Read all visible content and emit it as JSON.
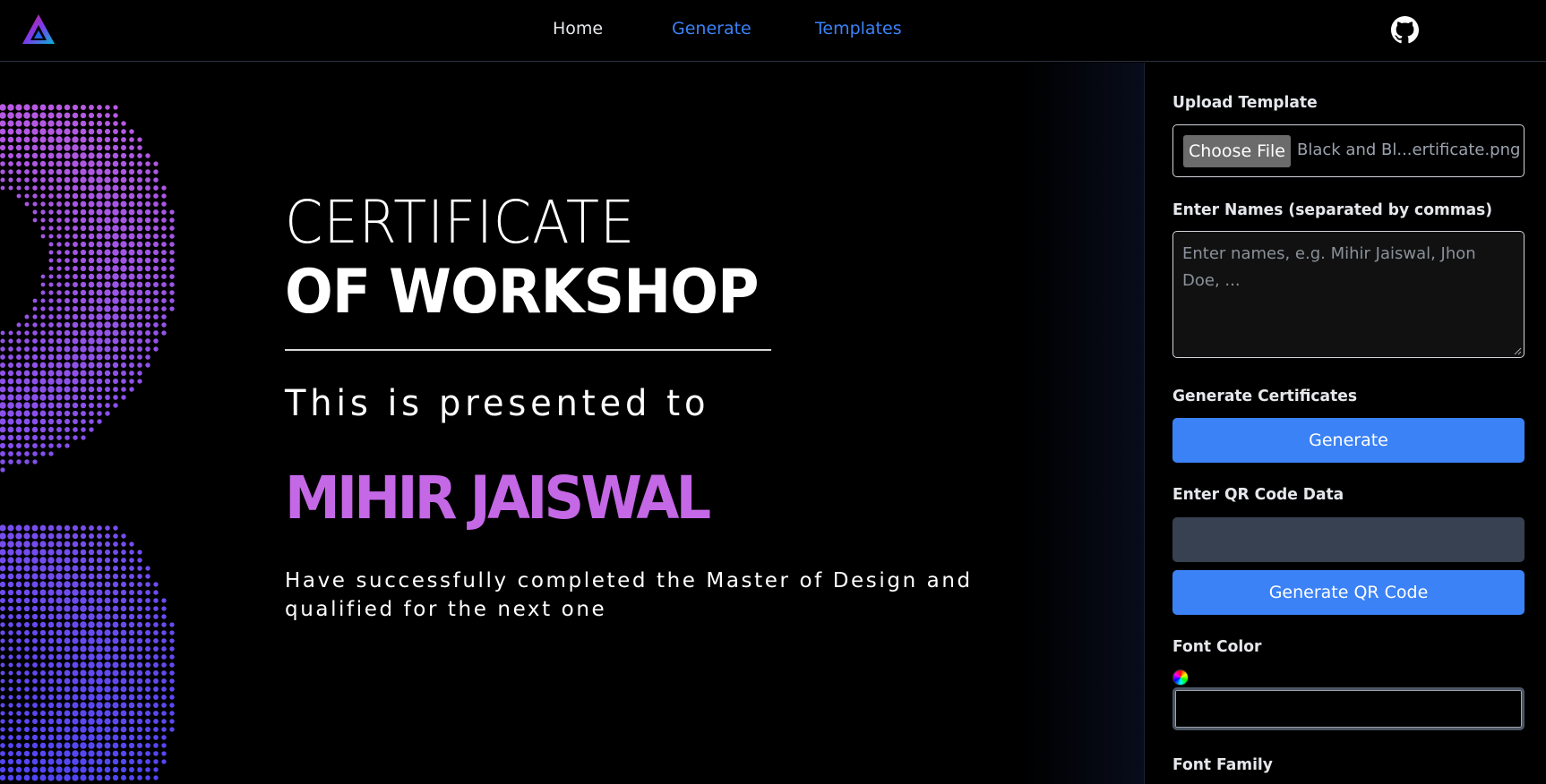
{
  "nav": {
    "links": [
      "Home",
      "Generate",
      "Templates"
    ],
    "home_color": "#e5e7eb",
    "link_color": "#3b82f6"
  },
  "icons": {
    "logo": "triangle-logo-icon",
    "github": "github-icon",
    "color_picker": "color-wheel-icon",
    "resize": "resize-grip-icon"
  },
  "certificate": {
    "line1": "CERTIFICATE",
    "line2": "OF WORKSHOP",
    "presented": "This is presented to",
    "name": "MIHIR JAISWAL",
    "description": "Have successfully completed the Master of Design and qualified for the next one",
    "name_color": "#c468e6",
    "accent_colors": [
      "#7c3aed",
      "#c468e6",
      "#2563eb"
    ]
  },
  "panel": {
    "upload_label": "Upload Template",
    "choose_file": "Choose File",
    "file_name": "Black and Bl...ertificate.png",
    "names_label": "Enter Names (separated by commas)",
    "names_placeholder": "Enter names, e.g. Mihir Jaiswal, Jhon Doe, ...",
    "names_value": "",
    "generate_label": "Generate Certificates",
    "generate_button": "Generate",
    "qr_label": "Enter QR Code Data",
    "qr_value": "",
    "qr_button": "Generate QR Code",
    "font_color_label": "Font Color",
    "font_color_value": "",
    "font_family_label": "Font Family",
    "button_color": "#3b82f6"
  }
}
